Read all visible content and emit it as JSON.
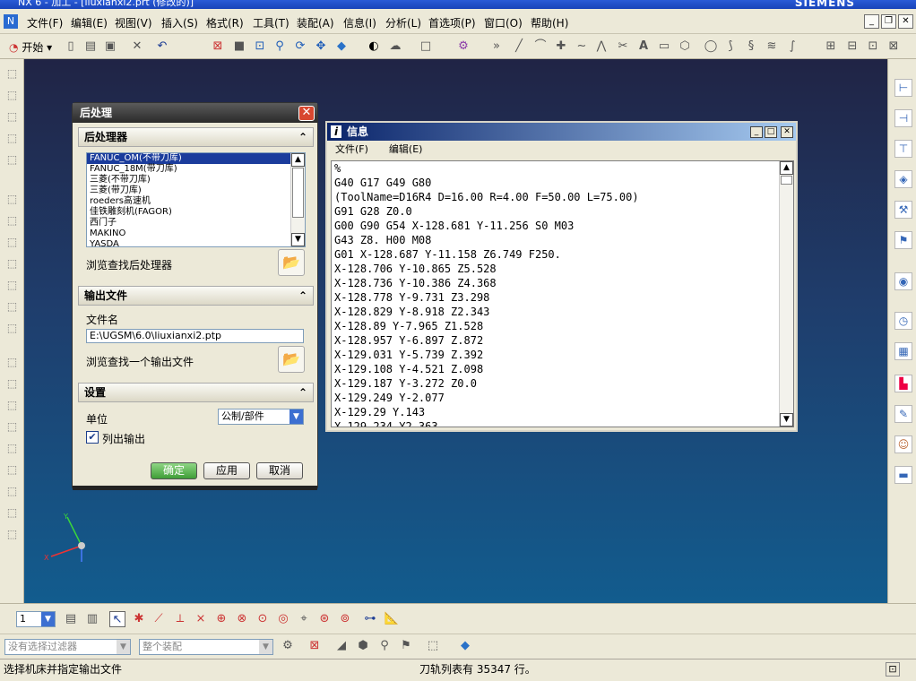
{
  "window": {
    "title": "NX 6 - 加工 - [liuxianxi2.prt (修改的)]",
    "brand": "SIEMENS"
  },
  "menu": [
    "文件(F)",
    "编辑(E)",
    "视图(V)",
    "插入(S)",
    "格式(R)",
    "工具(T)",
    "装配(A)",
    "信息(I)",
    "分析(L)",
    "首选项(P)",
    "窗口(O)",
    "帮助(H)"
  ],
  "toolbar": {
    "start_label": "开始"
  },
  "postprocess": {
    "title": "后处理",
    "group_postprocessor": "后处理器",
    "postprocessors": [
      "FANUC_OM(不带刀库)",
      "FANUC_18M(带刀库)",
      "三菱(不带刀库)",
      "三菱(带刀库)",
      "roeders高速机",
      "佳铁雕刻机(FAGOR)",
      "西门子",
      "MAKINO",
      "YASDA"
    ],
    "browse_post": "浏览查找后处理器",
    "group_output": "输出文件",
    "filename_label": "文件名",
    "filename_value": "E:\\UGSM\\6.0\\liuxianxi2.ptp",
    "browse_output": "浏览查找一个输出文件",
    "group_settings": "设置",
    "units_label": "单位",
    "units_value": "公制/部件",
    "list_output_label": "列出输出",
    "ok": "确定",
    "apply": "应用",
    "cancel": "取消"
  },
  "info": {
    "title": "信息",
    "menu_file": "文件(F)",
    "menu_edit": "编辑(E)",
    "text": "%\nG40 G17 G49 G80\n(ToolName=D16R4 D=16.00 R=4.00 F=50.00 L=75.00)\nG91 G28 Z0.0\nG00 G90 G54 X-128.681 Y-11.256 S0 M03\nG43 Z8. H00 M08\nG01 X-128.687 Y-11.158 Z6.749 F250.\nX-128.706 Y-10.865 Z5.528\nX-128.736 Y-10.386 Z4.368\nX-128.778 Y-9.731 Z3.298\nX-128.829 Y-8.918 Z2.343\nX-128.89 Y-7.965 Z1.528\nX-128.957 Y-6.897 Z.872\nX-129.031 Y-5.739 Z.392\nX-129.108 Y-4.521 Z.098\nX-129.187 Y-3.272 Z0.0\nX-129.249 Y-2.077\nX-129.29 Y.143\nX-129.234 Y2.363"
  },
  "bottom": {
    "layer_value": "1",
    "filter_placeholder": "没有选择过滤器",
    "assembly_placeholder": "整个装配"
  },
  "status": {
    "prompt": "选择机床并指定输出文件",
    "message": "刀轨列表有 35347 行。"
  },
  "axes": {
    "x": "X",
    "y": "Y"
  }
}
